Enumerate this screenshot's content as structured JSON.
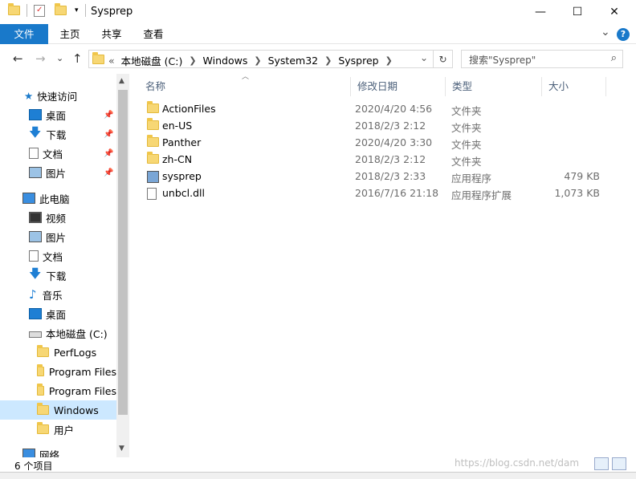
{
  "window": {
    "title": "Sysprep",
    "minimize": "—",
    "maximize": "☐",
    "close": "✕"
  },
  "ribbon": {
    "tabs": [
      "文件",
      "主页",
      "共享",
      "查看"
    ],
    "expand": "⌄",
    "help": "?"
  },
  "nav": {
    "back": "←",
    "forward": "→",
    "recent": "⌄",
    "up": "↑"
  },
  "address": {
    "overflow": "«",
    "crumbs": [
      "本地磁盘 (C:)",
      "Windows",
      "System32",
      "Sysprep"
    ],
    "dropdown": "⌄",
    "refresh": "↻"
  },
  "search": {
    "placeholder": "搜索\"Sysprep\"",
    "icon": "⌕"
  },
  "navpane": {
    "quick_access": "快速访问",
    "quick_items": [
      "桌面",
      "下载",
      "文档",
      "图片"
    ],
    "this_pc": "此电脑",
    "pc_items": [
      "视频",
      "图片",
      "文档",
      "下载",
      "音乐",
      "桌面"
    ],
    "local_disk": "本地磁盘 (C:)",
    "disk_items": [
      "PerfLogs",
      "Program Files",
      "Program Files",
      "Windows",
      "用户"
    ],
    "network": "网络"
  },
  "columns": {
    "name": "名称",
    "date": "修改日期",
    "type": "类型",
    "size": "大小"
  },
  "files": [
    {
      "name": "ActionFiles",
      "date": "2020/4/20 4:56",
      "type": "文件夹",
      "size": "",
      "icon": "folder-icon"
    },
    {
      "name": "en-US",
      "date": "2018/2/3 2:12",
      "type": "文件夹",
      "size": "",
      "icon": "folder-icon"
    },
    {
      "name": "Panther",
      "date": "2020/4/20 3:30",
      "type": "文件夹",
      "size": "",
      "icon": "folder-icon"
    },
    {
      "name": "zh-CN",
      "date": "2018/2/3 2:12",
      "type": "文件夹",
      "size": "",
      "icon": "folder-icon"
    },
    {
      "name": "sysprep",
      "date": "2018/2/3 2:33",
      "type": "应用程序",
      "size": "479 KB",
      "icon": "application-icon"
    },
    {
      "name": "unbcl.dll",
      "date": "2016/7/16 21:18",
      "type": "应用程序扩展",
      "size": "1,073 KB",
      "icon": "dll-file-icon"
    }
  ],
  "status": {
    "count": "6 个项目"
  },
  "watermark": "https://blog.csdn.net/dam",
  "colors": {
    "accent": "#1979ca",
    "selected": "#cce8ff",
    "folder": "#f7d774"
  }
}
